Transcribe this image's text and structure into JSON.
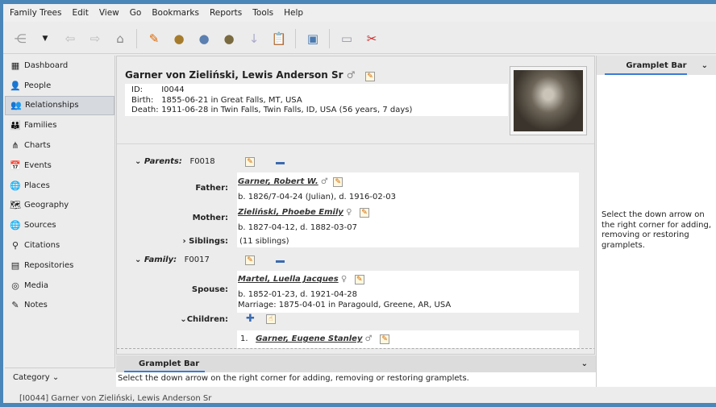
{
  "menu": [
    "Family Trees",
    "Edit",
    "View",
    "Go",
    "Bookmarks",
    "Reports",
    "Tools",
    "Help"
  ],
  "toolbar": [
    "tree-icon",
    "dropdown-icon",
    "back-icon",
    "forward-icon",
    "home-icon",
    "edit-icon",
    "add-person-icon",
    "add-family-icon",
    "people-icon",
    "down-arrow-icon",
    "clipboard-icon",
    "config-view-icon",
    "media-icon",
    "cut-icon"
  ],
  "sidebar": {
    "items": [
      {
        "label": "Dashboard",
        "icon": "▦"
      },
      {
        "label": "People",
        "icon": "👤"
      },
      {
        "label": "Relationships",
        "icon": "👥"
      },
      {
        "label": "Families",
        "icon": "👪"
      },
      {
        "label": "Charts",
        "icon": "⋔"
      },
      {
        "label": "Events",
        "icon": "📅"
      },
      {
        "label": "Places",
        "icon": "🌐"
      },
      {
        "label": "Geography",
        "icon": "🗺"
      },
      {
        "label": "Sources",
        "icon": "🌐"
      },
      {
        "label": "Citations",
        "icon": "⚲"
      },
      {
        "label": "Repositories",
        "icon": "▤"
      },
      {
        "label": "Media",
        "icon": "◎"
      },
      {
        "label": "Notes",
        "icon": "✎"
      }
    ],
    "category": "Category"
  },
  "person": {
    "name": "Garner von Zieliński, Lewis Anderson Sr",
    "gender": "♂",
    "id_label": "ID:",
    "id": "I0044",
    "birth_label": "Birth:",
    "birth": "1855-06-21 in Great Falls, MT, USA",
    "death_label": "Death:",
    "death": "1911-06-28 in Twin Falls, Twin Falls, ID, USA (56 years, 7 days)"
  },
  "parents": {
    "label": "Parents:",
    "id": "F0018",
    "father_label": "Father:",
    "father": "Garner, Robert W.",
    "father_gender": "♂",
    "father_dates": "b. 1826/7-04-24 (Julian), d. 1916-02-03",
    "mother_label": "Mother:",
    "mother": "Zieliński, Phoebe Emily",
    "mother_gender": "♀",
    "mother_dates": "b. 1827-04-12, d. 1882-03-07",
    "siblings_label": "Siblings:",
    "siblings": "(11 siblings)"
  },
  "family": {
    "label": "Family:",
    "id": "F0017",
    "spouse_label": "Spouse:",
    "spouse": "Martel, Luella Jacques",
    "spouse_gender": "♀",
    "spouse_dates": "b. 1852-01-23, d. 1921-04-28",
    "marriage": "Marriage: 1875-04-01 in Paragould, Greene, AR, USA",
    "children_label": "Children:",
    "child_num": "1.",
    "child": "Garner, Eugene Stanley",
    "child_gender": "♂"
  },
  "right_gramplet": {
    "title": "Gramplet Bar",
    "text": "Select the down arrow on the right corner for adding, removing or restoring gramplets."
  },
  "bottom_gramplet": {
    "title": "Gramplet Bar",
    "text": "Select the down arrow on the right corner for adding, removing or restoring gramplets."
  },
  "status": "[I0044] Garner von Zieliński, Lewis Anderson Sr"
}
